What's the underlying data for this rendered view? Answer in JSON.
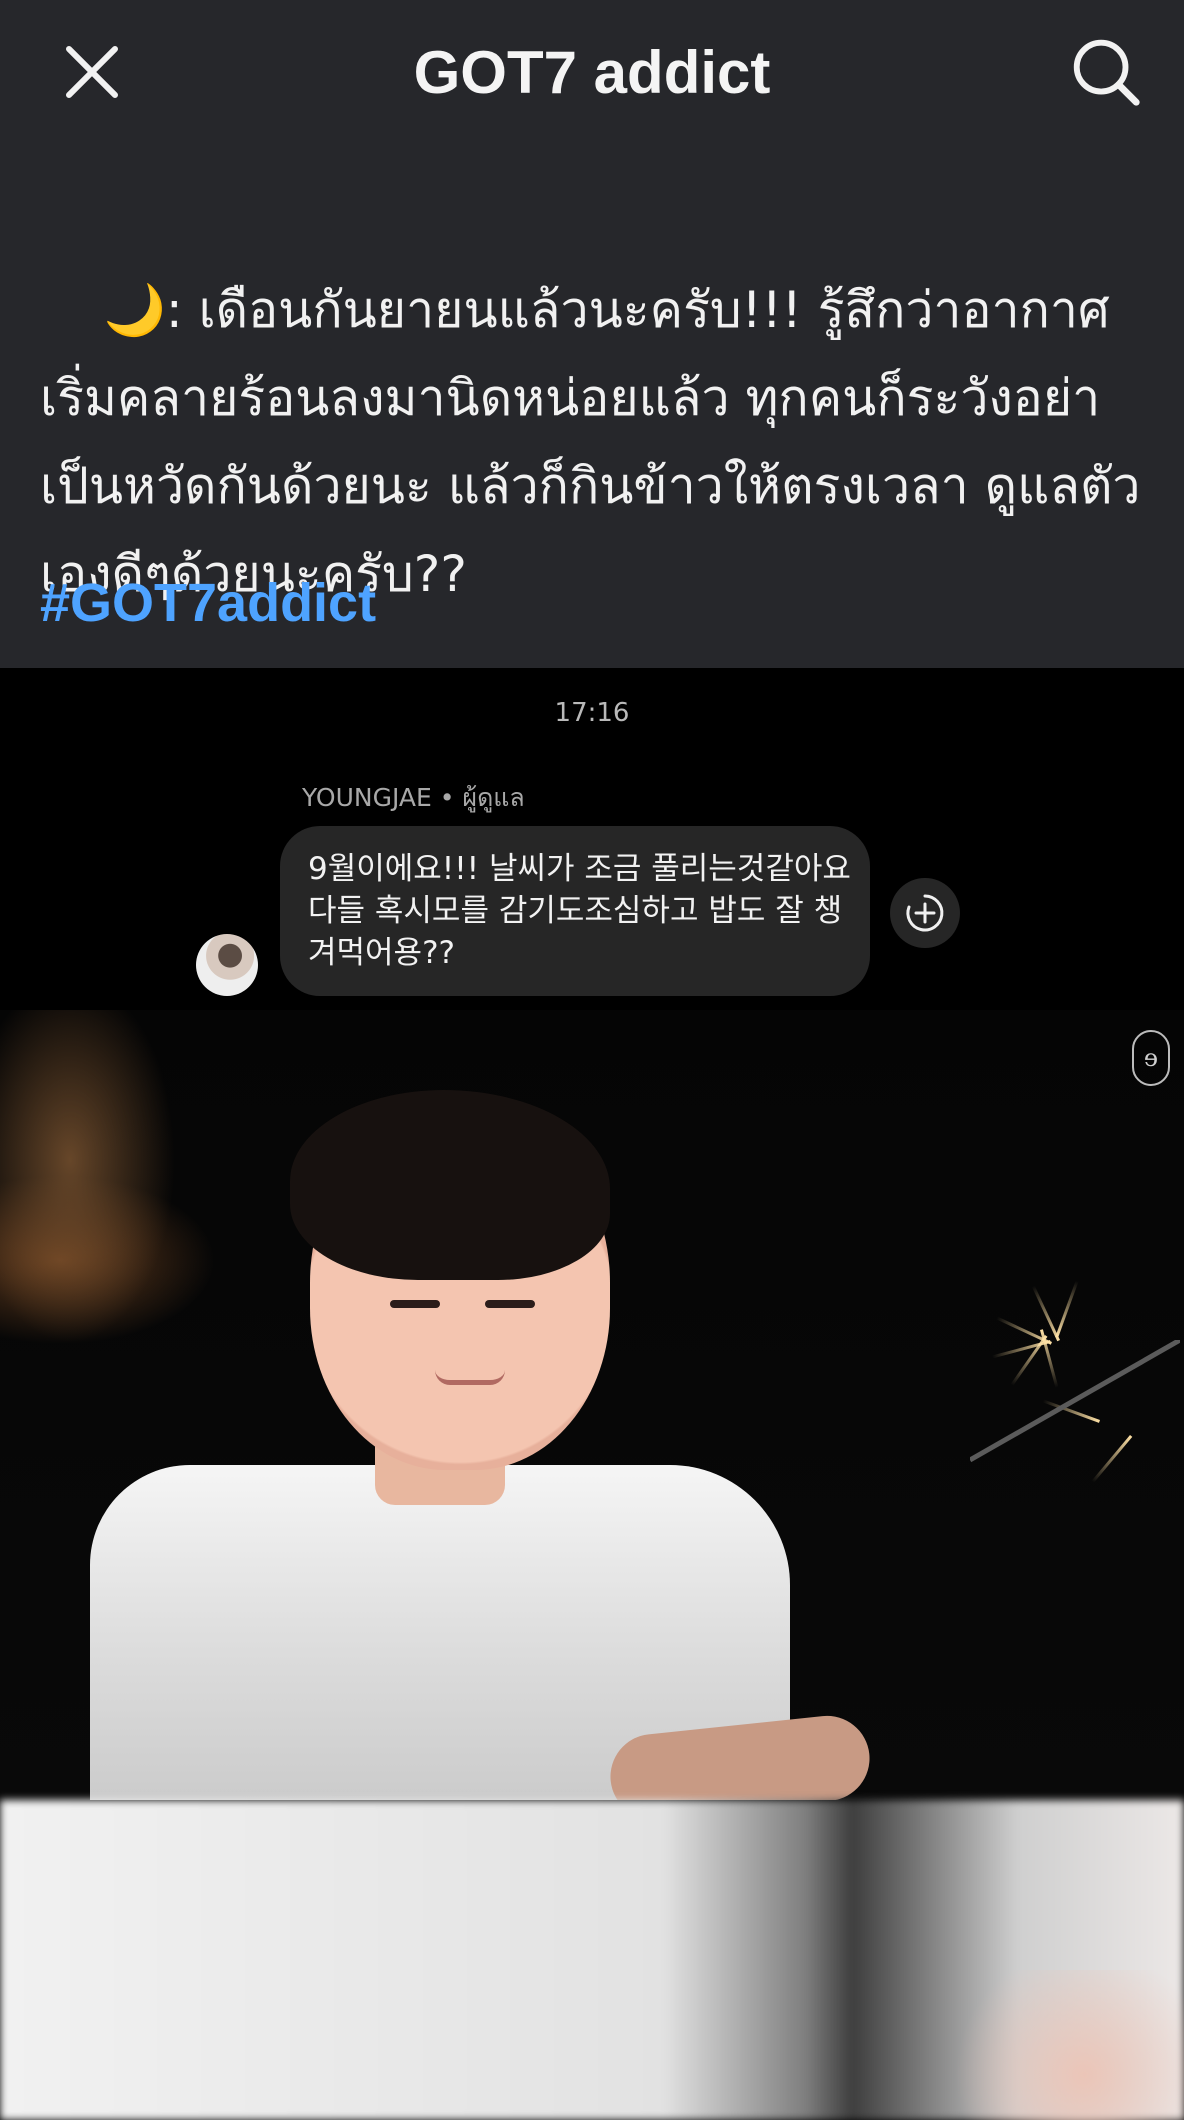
{
  "header": {
    "title": "GOT7 addict",
    "close_icon": "close-icon",
    "search_icon": "search-icon"
  },
  "post": {
    "emoji": "🌙",
    "text": ": เดือนกันยายนแล้วนะครับ!!! รู้สึกว่าอากาศเริ่มคลายร้อนลงมานิดหน่อยแล้ว ทุกคนก็ระวังอย่าเป็นหวัดกันด้วยนะ แล้วก็กินข้าวให้ตรงเวลา ดูแลตัวเองดีๆด้วยนะครับ??",
    "hashtag": "#GOT7addict"
  },
  "chat": {
    "timestamp": "17:16",
    "sender": "YOUNGJAE • ผู้ดูแล",
    "message": "9월이에요!!!  날씨가 조금 풀리는것같아요 다들 혹시모를 감기도조심하고 밥도 잘 챙겨먹어용??",
    "react_icon": "add-reaction-icon"
  },
  "brand": {
    "mark_icon": "brand-logo-icon"
  },
  "colors": {
    "background": "#26272b",
    "hashtag": "#4ea3ff"
  }
}
